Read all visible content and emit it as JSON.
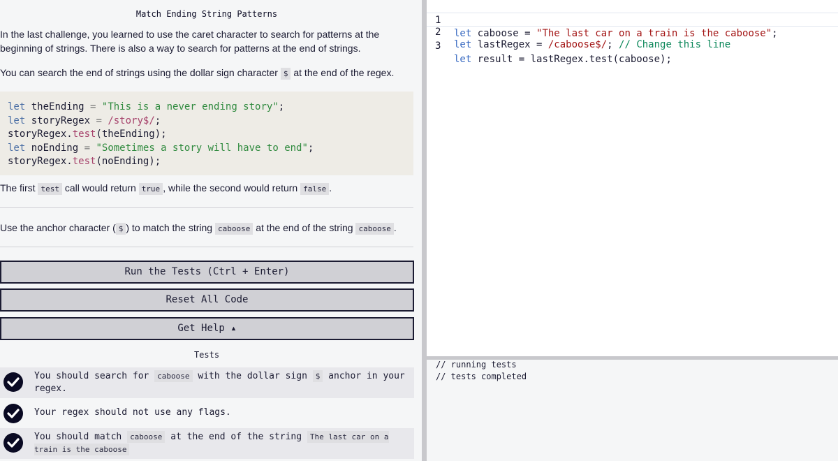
{
  "challenge": {
    "title": "Match Ending String Patterns",
    "intro_1": "In the last challenge, you learned to use the caret character to search for patterns at the beginning of strings. There is also a way to search for patterns at the end of strings.",
    "intro_2_before": "You can search the end of strings using the dollar sign character ",
    "intro_2_code": "$",
    "intro_2_after": " at the end of the regex.",
    "example_code": [
      "let theEnding = \"This is a never ending story\";",
      "let storyRegex = /story$/;",
      "storyRegex.test(theEnding);",
      "let noEnding = \"Sometimes a story will have to end\";",
      "storyRegex.test(noEnding);"
    ],
    "result_1": "The first ",
    "result_code_1": "test",
    "result_2": " call would return ",
    "result_code_2": "true",
    "result_3": ", while the second would return ",
    "result_code_3": "false",
    "result_4": ".",
    "task_1": "Use the anchor character (",
    "task_code_1": "$",
    "task_2": ") to match the string ",
    "task_code_2": "caboose",
    "task_3": " at the end of the string ",
    "task_code_3": "caboose",
    "task_4": "."
  },
  "buttons": {
    "run": "Run the Tests (Ctrl + Enter)",
    "reset": "Reset All Code",
    "help": "Get Help ▴"
  },
  "tests": {
    "heading": "Tests",
    "items": [
      {
        "t1": "You should search for ",
        "c1": "caboose",
        "t2": " with the dollar sign ",
        "c2": "$",
        "t3": " anchor in your regex.",
        "passed": true
      },
      {
        "t1": "Your regex should not use any flags.",
        "passed": true
      },
      {
        "t1": "You should match ",
        "c1": "caboose",
        "t2": " at the end of the string ",
        "c2": "The last car on a train is the caboose",
        "passed": true
      }
    ]
  },
  "editor": {
    "lines": [
      {
        "num": "1",
        "kw": "let",
        "var": " caboose = ",
        "str": "\"The last car on a train is the caboose\"",
        "rest": ";",
        "cm": ""
      },
      {
        "num": "2",
        "kw": "let",
        "var": " lastRegex = ",
        "str": "/caboose$/",
        "rest": "; ",
        "cm": "// Change this line"
      },
      {
        "num": "3",
        "kw": "let",
        "var": " result = lastRegex.test(caboose);",
        "str": "",
        "rest": "",
        "cm": ""
      }
    ]
  },
  "console": {
    "lines": [
      "// running tests",
      "// tests completed"
    ]
  },
  "colors": {
    "text": "#1b1b32",
    "left_bg": "#f5f6f7",
    "button_bg": "#d0d0d5",
    "check_bg": "#0a0a23"
  }
}
